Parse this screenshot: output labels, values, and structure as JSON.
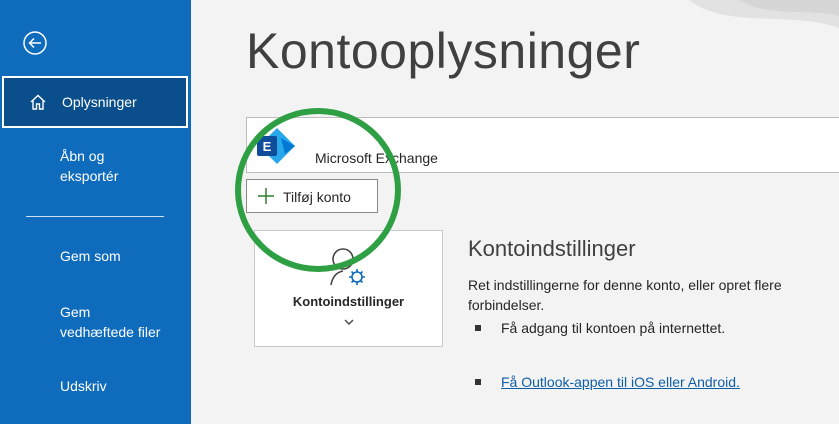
{
  "sidebar": {
    "back_icon": "back-arrow-icon",
    "items": [
      {
        "label": "Oplysninger",
        "icon": "home-icon",
        "selected": true
      },
      {
        "label": "Åbn og\neksportér"
      },
      {
        "label": "Gem som"
      },
      {
        "label": "Gem\nvedhæftede filer"
      },
      {
        "label": "Udskriv"
      }
    ]
  },
  "main": {
    "title": "Kontooplysninger",
    "account": {
      "name": "Microsoft Exchange",
      "logo_icon": "exchange-logo-icon"
    },
    "add_account_label": "Tilføj konto",
    "settings_tile": {
      "label": "Kontoindstillinger",
      "icon": "account-settings-icon"
    },
    "settings_section": {
      "heading": "Kontoindstillinger",
      "description": "Ret indstillingerne for denne konto, eller opret flere forbindelser.",
      "bullets": [
        {
          "text": "Få adgang til kontoen på internettet.",
          "link": false
        },
        {
          "text": "Få Outlook-appen til iOS eller Android.",
          "link": true
        }
      ]
    }
  },
  "colors": {
    "sidebar": "#0f6cbd",
    "sidebar_selected": "#0a4e8c",
    "annotation_circle": "#2ea043",
    "link": "#0f5ea8"
  }
}
